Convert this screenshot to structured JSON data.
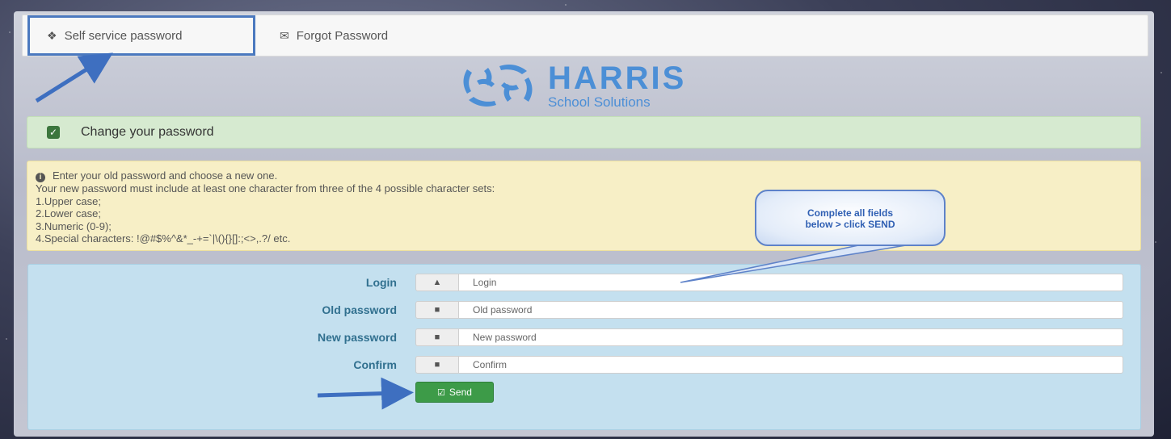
{
  "nav": {
    "tabs": [
      {
        "label": "Self service password",
        "icon": "home-icon",
        "active": true
      },
      {
        "label": "Forgot Password",
        "icon": "envelope-icon",
        "active": false
      }
    ]
  },
  "logo": {
    "brand": "HARRIS",
    "subtitle": "School Solutions"
  },
  "success": {
    "text": "Change your password"
  },
  "instructions": {
    "intro": "Enter your old password and choose a new one.",
    "rule": "Your new password must include at least one character from three of the 4 possible character sets:",
    "items": [
      "1.Upper case;",
      "2.Lower case;",
      "3.Numeric (0-9);",
      "4.Special characters: !@#$%^&*_-+=`|\\(){}[]:;<>,.?/ etc."
    ]
  },
  "form": {
    "fields": [
      {
        "label": "Login",
        "placeholder": "Login",
        "icon": "user-icon"
      },
      {
        "label": "Old password",
        "placeholder": "Old password",
        "icon": "lock-icon"
      },
      {
        "label": "New password",
        "placeholder": "New password",
        "icon": "lock-icon"
      },
      {
        "label": "Confirm",
        "placeholder": "Confirm",
        "icon": "lock-icon"
      }
    ],
    "send_label": "Send"
  },
  "callout": {
    "line1": "Complete all fields",
    "line2": "below > click SEND"
  },
  "colors": {
    "accent": "#4b79bf",
    "success": "#3d9b48",
    "label": "#31708f",
    "logo": "#4c8fd6"
  }
}
